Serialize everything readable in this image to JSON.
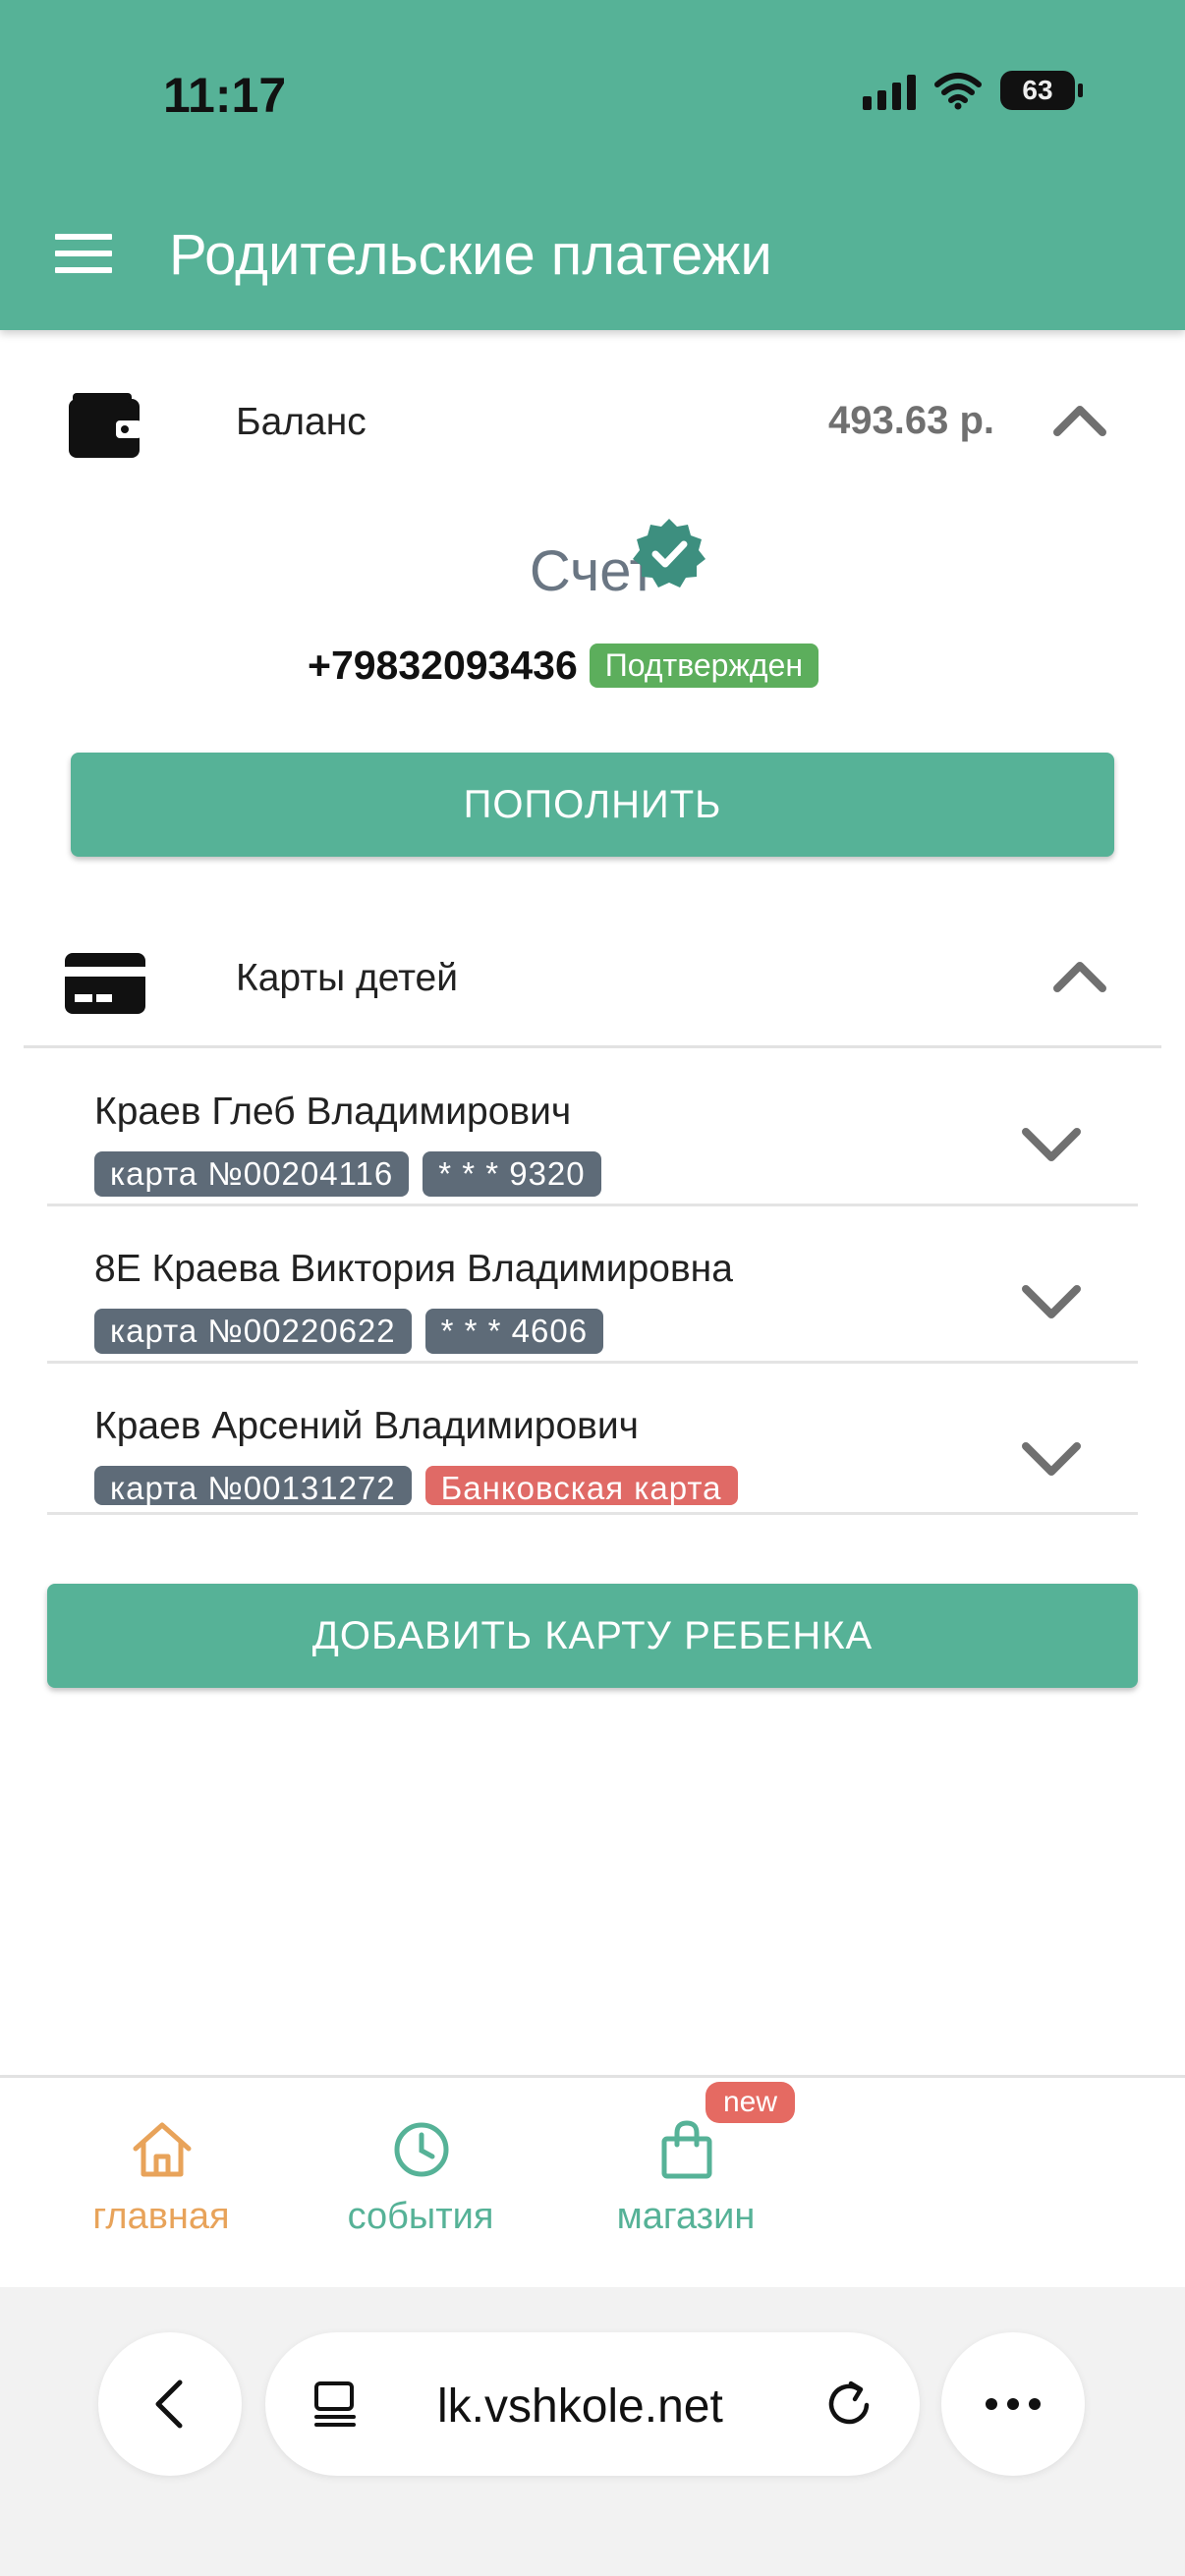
{
  "status": {
    "time": "11:17",
    "battery": "63"
  },
  "header": {
    "title": "Родительские платежи"
  },
  "balance": {
    "label": "Баланс",
    "value": "493.63 р."
  },
  "account": {
    "title": "Счет",
    "phone": "+79832093436",
    "status": "Подтвержден",
    "topup_label": "ПОПОЛНИТЬ"
  },
  "cards_section": {
    "label": "Карты детей",
    "children": [
      {
        "name": "Краев Глеб Владимирович",
        "card": "карта №00204116",
        "extra": "* * * 9320"
      },
      {
        "name": "8Е Краева Виктория Владимировна",
        "card": "карта №00220622",
        "extra": "* * * 4606"
      },
      {
        "name": "Краев Арсений Владимирович",
        "card": "карта №00131272",
        "extra": "Банковская карта"
      }
    ],
    "add_label": "ДОБАВИТЬ КАРТУ РЕБЕНКА"
  },
  "bottom_nav": {
    "home": "главная",
    "events": "события",
    "shop": "магазин",
    "shop_badge": "new",
    "colors": {
      "active": "#e8a35a",
      "inactive": "#56b297",
      "badge": "#e56a62"
    }
  },
  "browser": {
    "url": "lk.vshkole.net"
  },
  "theme": {
    "accent": "#56b297",
    "tag": "#5e6b78",
    "confirmed": "#5cae5c",
    "bank_tag": "#e06a66"
  }
}
